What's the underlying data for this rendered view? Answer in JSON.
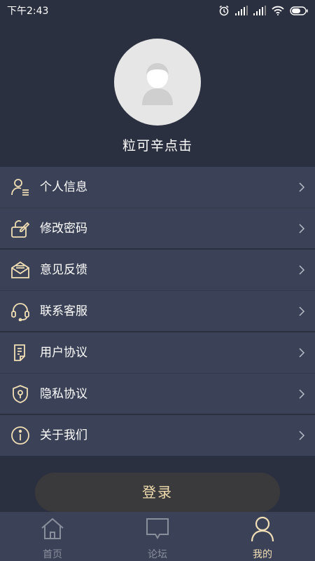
{
  "status_bar": {
    "time": "下午2:43",
    "icons": [
      "alarm-icon",
      "signal-icon",
      "signal-icon",
      "wifi-icon",
      "battery-icon"
    ]
  },
  "profile": {
    "avatar_icon": "default-avatar-icon",
    "username": "粒可辛点击"
  },
  "menu": {
    "groups": [
      [
        {
          "label": "个人信息",
          "icon": "user-info-icon"
        },
        {
          "label": "修改密码",
          "icon": "edit-lock-icon"
        }
      ],
      [
        {
          "label": "意见反馈",
          "icon": "mail-icon"
        },
        {
          "label": "联系客服",
          "icon": "headset-icon"
        }
      ],
      [
        {
          "label": "用户协议",
          "icon": "document-icon"
        },
        {
          "label": "隐私协议",
          "icon": "shield-icon"
        }
      ],
      [
        {
          "label": "关于我们",
          "icon": "info-icon"
        }
      ]
    ]
  },
  "login_button": {
    "label": "登录"
  },
  "tab_bar": {
    "tabs": [
      {
        "label": "首页",
        "icon": "home-icon",
        "active": false
      },
      {
        "label": "论坛",
        "icon": "chat-icon",
        "active": false
      },
      {
        "label": "我的",
        "icon": "person-icon",
        "active": true
      }
    ]
  },
  "colors": {
    "background": "#2b3040",
    "menu_item": "#3b4257",
    "accent_gold": "#f2dfb5",
    "inactive_tab": "#8a8f9c"
  }
}
